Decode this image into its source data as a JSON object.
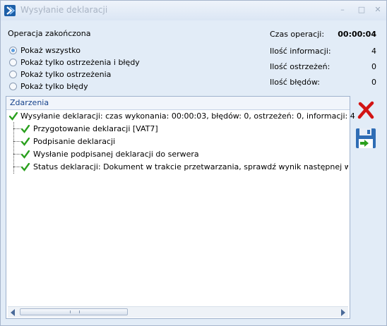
{
  "window": {
    "title": "Wysyłanie deklaracji",
    "minimize_glyph": "–",
    "maximize_glyph": "□",
    "close_glyph": "✕"
  },
  "status": {
    "heading": "Operacja zakończona"
  },
  "filters": [
    {
      "label": "Pokaż wszystko",
      "selected": true
    },
    {
      "label": "Pokaż tylko ostrzeżenia i błędy",
      "selected": false
    },
    {
      "label": "Pokaż tylko ostrzeżenia",
      "selected": false
    },
    {
      "label": "Pokaż tylko błędy",
      "selected": false
    }
  ],
  "stats": {
    "time_label": "Czas operacji:",
    "time_value": "00:00:04",
    "info_label": "Ilość informacji:",
    "info_value": "4",
    "warnings_label": "Ilość ostrzeżeń:",
    "warnings_value": "0",
    "errors_label": "Ilość błędów:",
    "errors_value": "0"
  },
  "events": {
    "header": "Zdarzenia",
    "root": "Wysyłanie deklaracji: czas wykonania: 00:00:03, błędów: 0, ostrzeżeń: 0, informacji: 4",
    "children": [
      "Przygotowanie deklaracji [VAT7]",
      "Podpisanie deklaracji",
      "Wysłanie podpisanej deklaracji do serwera",
      "Status deklaracji: Dokument w trakcie przetwarzania, sprawdź wynik następnej weryfikacji do"
    ]
  },
  "icons": {
    "app": "comarch-app-icon",
    "check": "green-check-icon",
    "cancel": "red-x-icon",
    "save": "floppy-disk-icon"
  },
  "colors": {
    "check_green": "#2aa01e",
    "cancel_red": "#d21414",
    "header_text": "#15428b"
  }
}
